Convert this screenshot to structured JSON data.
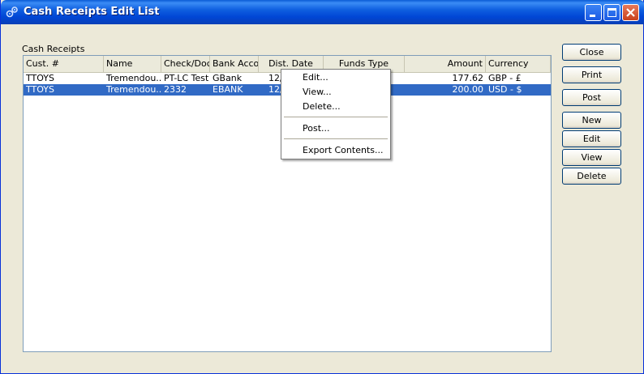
{
  "window": {
    "title": "Cash Receipts Edit List"
  },
  "group_label": "Cash Receipts",
  "columns": [
    "Cust. #",
    "Name",
    "Check/Doc",
    "Bank Accou",
    "Dist. Date",
    "Funds Type",
    "Amount",
    "Currency"
  ],
  "rows": [
    {
      "cust": "TTOYS",
      "name": "Tremendou...",
      "check": "PT-LC Test",
      "bank": "GBank",
      "dist": "12/",
      "funds": "",
      "amount": "177.62",
      "currency": "GBP - £",
      "selected": false
    },
    {
      "cust": "TTOYS",
      "name": "Tremendou...",
      "check": "2332",
      "bank": "EBANK",
      "dist": "12/",
      "funds": "",
      "amount": "200.00",
      "currency": "USD - $",
      "selected": true
    }
  ],
  "buttons": {
    "close": "Close",
    "print": "Print",
    "post": "Post",
    "new": "New",
    "edit": "Edit",
    "view": "View",
    "delete": "Delete"
  },
  "context_menu": {
    "edit": "Edit...",
    "view": "View...",
    "delete": "Delete...",
    "post": "Post...",
    "export": "Export Contents..."
  },
  "colors": {
    "selection": "#316ac5",
    "titlebar": "#0a5bd6"
  }
}
